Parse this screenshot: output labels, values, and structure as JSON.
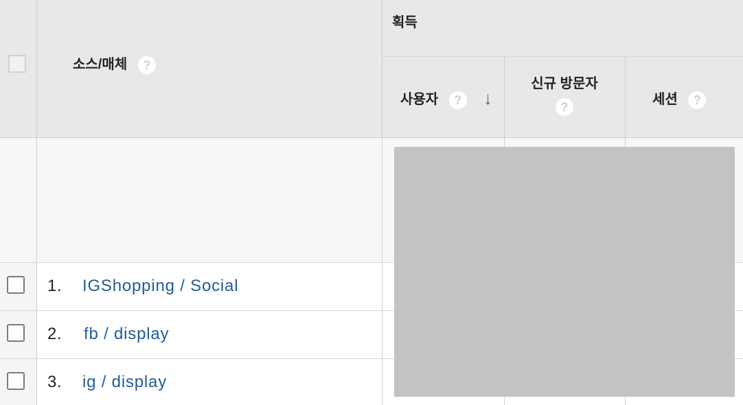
{
  "header": {
    "group_title": "획득",
    "source_medium_label": "소스/매체",
    "users_label": "사용자",
    "new_visitors_label": "신규 방문자",
    "sessions_label": "세션",
    "help_glyph": "?",
    "sort_glyph": "↓"
  },
  "rows": [
    {
      "index": "1.",
      "label": "IGShopping / Social"
    },
    {
      "index": "2.",
      "label": "fb / display"
    },
    {
      "index": "3.",
      "label": "ig / display"
    }
  ],
  "colors": {
    "header_bg": "#e8e8e8",
    "summary_bg": "#f7f7f7",
    "link": "#1f5d99",
    "redaction": "#c3c3c3"
  }
}
